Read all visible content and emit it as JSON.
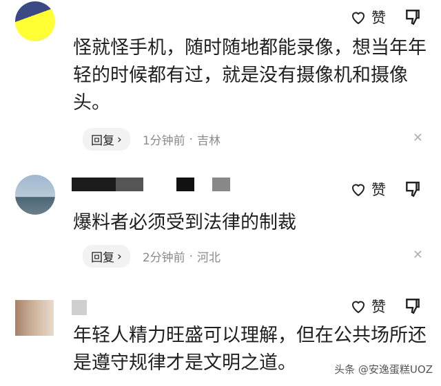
{
  "comments": [
    {
      "text": "怪就怪手机，随时随地都能录像，想当年年轻的时候都有过，就是没有摄像机和摄像头。",
      "like_label": "赞",
      "reply_label": "回复",
      "time": "1分钟前",
      "location": "吉林"
    },
    {
      "text": "爆料者必须受到法律的制裁",
      "like_label": "赞",
      "reply_label": "回复",
      "time": "2分钟前",
      "location": "河北"
    },
    {
      "text": "年轻人精力旺盛可以理解，但在公共场所还是遵守规律才是文明之道。",
      "like_label": "赞"
    }
  ],
  "meta_separator": "·",
  "close_glyph": "✕",
  "reply_chevron": "›",
  "watermark": "头条 @安逸蛋糕UOZ",
  "icons": {
    "like": "thumbs-up-outline-icon",
    "dislike": "thumbs-down-outline-icon"
  }
}
